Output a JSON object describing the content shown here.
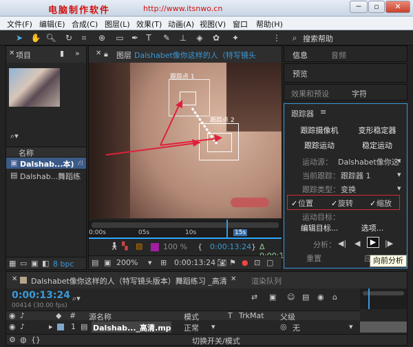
{
  "titlebar": {
    "title": "电脑制作软件",
    "url": "http://www.itsnwo.cn"
  },
  "menu": [
    "文件(F)",
    "编辑(E)",
    "合成(C)",
    "图层(L)",
    "效果(T)",
    "动画(A)",
    "视图(V)",
    "窗口",
    "帮助(H)"
  ],
  "toolbar": {
    "search_label": "搜索帮助"
  },
  "project": {
    "tab_label": "项目",
    "col_name": "名称",
    "items": [
      {
        "name": "Dalshab...本)"
      },
      {
        "name": "Dalshab...舞蹈练"
      }
    ],
    "bpc": "8 bpc"
  },
  "viewer": {
    "tab_prefix": "图层",
    "tab_label": "Dalshabet像你这样的人（特写镜头",
    "track_point_1": "跟踪点 1",
    "track_point_2": "跟踪点 2",
    "ruler": [
      "0:00s",
      "05s",
      "10s",
      "15s"
    ],
    "zoom_pct": "100 %",
    "time_in": "0:00:13:24",
    "duration": "Δ 0:00:13:24",
    "zoom": "200%",
    "timecode": "0:00:13:24"
  },
  "right_tabs": {
    "info": "信息",
    "audio": "音频",
    "preview": "预览",
    "effects": "效果和预设",
    "character": "字符"
  },
  "tracker": {
    "title": "跟踪器",
    "track_camera": "跟踪摄像机",
    "warp_stabilizer": "变形稳定器",
    "track_motion": "跟踪运动",
    "stabilize_motion": "稳定运动",
    "motion_source_label": "运动源：",
    "motion_source_value": "Dalshabet像你这·",
    "current_track_label": "当前跟踪：",
    "current_track_value": "跟踪器 1",
    "track_type_label": "跟踪类型：",
    "track_type_value": "变换",
    "position": "位置",
    "rotation": "旋转",
    "scale": "缩放",
    "motion_target_label": "运动目标：",
    "edit_target": "编辑目标...",
    "options": "选项...",
    "analyze_label": "分析：",
    "reset": "重置",
    "apply": "应用",
    "tooltip": "向前分析"
  },
  "timeline": {
    "tab_label": "Dalshabet像你这样的人（特写镜头版本）舞蹈练习 _高清",
    "render_queue": "渲染队列",
    "timecode": "0:00:13:24",
    "frames": "00414 (30.00 fps)",
    "cols": {
      "name": "源名称",
      "mode": "模式",
      "t": "T",
      "trkmat": "TrkMat",
      "parent": "父级"
    },
    "layer": {
      "num": "1",
      "name": "Dalshab..._高清.mp4",
      "mode": "正常",
      "parent": "无"
    },
    "footer": "切换开关/模式"
  },
  "colors": {
    "accent": "#3a9ad9",
    "arrow": "#e0203a",
    "highlight_box": "#d42a3a"
  }
}
